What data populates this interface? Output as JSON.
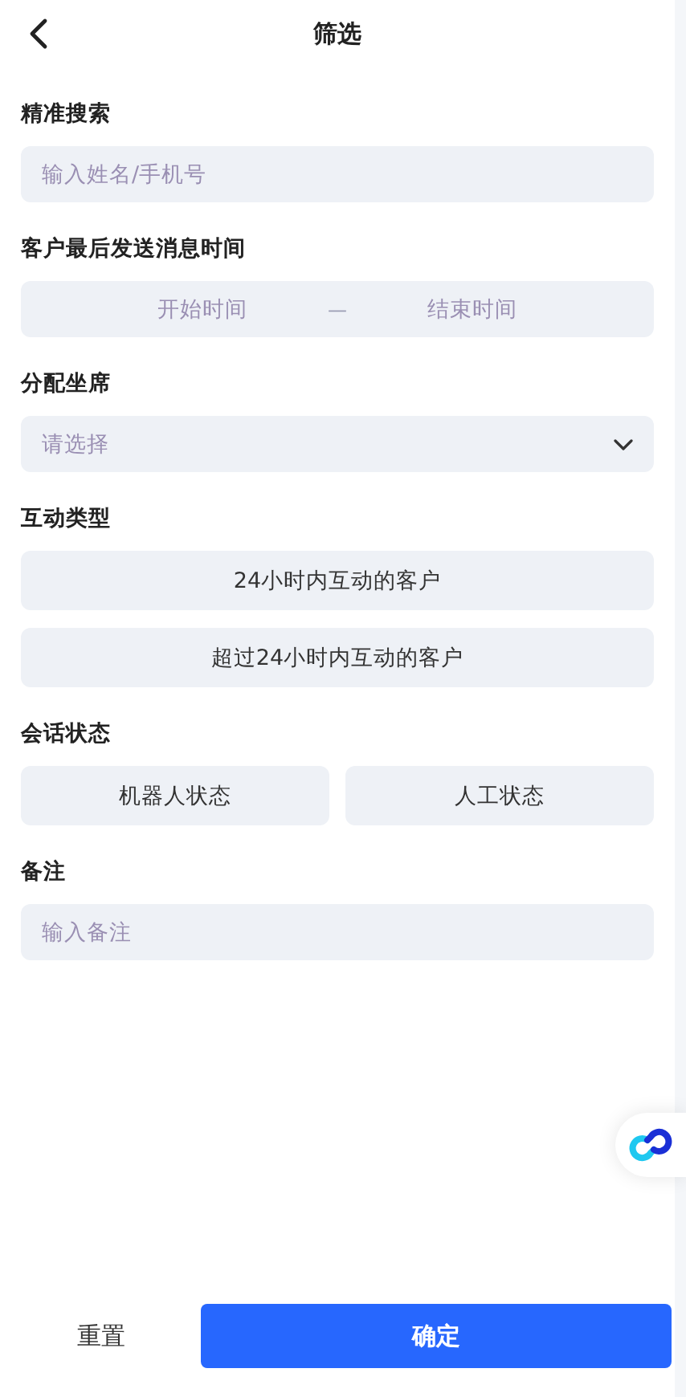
{
  "header": {
    "title": "筛选"
  },
  "sections": [
    {
      "kind": "input",
      "label": "精准搜索",
      "placeholder": "输入姓名/手机号"
    },
    {
      "kind": "range",
      "label": "客户最后发送消息时间",
      "start_placeholder": "开始时间",
      "separator": "—",
      "end_placeholder": "结束时间"
    },
    {
      "kind": "select",
      "label": "分配坐席",
      "placeholder": "请选择"
    },
    {
      "kind": "options_stack",
      "label": "互动类型",
      "options": [
        {
          "label": "24小时内互动的客户",
          "selected": false
        },
        {
          "label": "超过24小时内互动的客户",
          "selected": false
        }
      ]
    },
    {
      "kind": "options_row",
      "label": "会话状态",
      "options": [
        {
          "label": "机器人状态",
          "selected": false
        },
        {
          "label": "人工状态",
          "selected": false
        }
      ]
    },
    {
      "kind": "input",
      "label": "备注",
      "placeholder": "输入备注"
    }
  ],
  "footer": {
    "reset": "重置",
    "confirm": "确定"
  }
}
